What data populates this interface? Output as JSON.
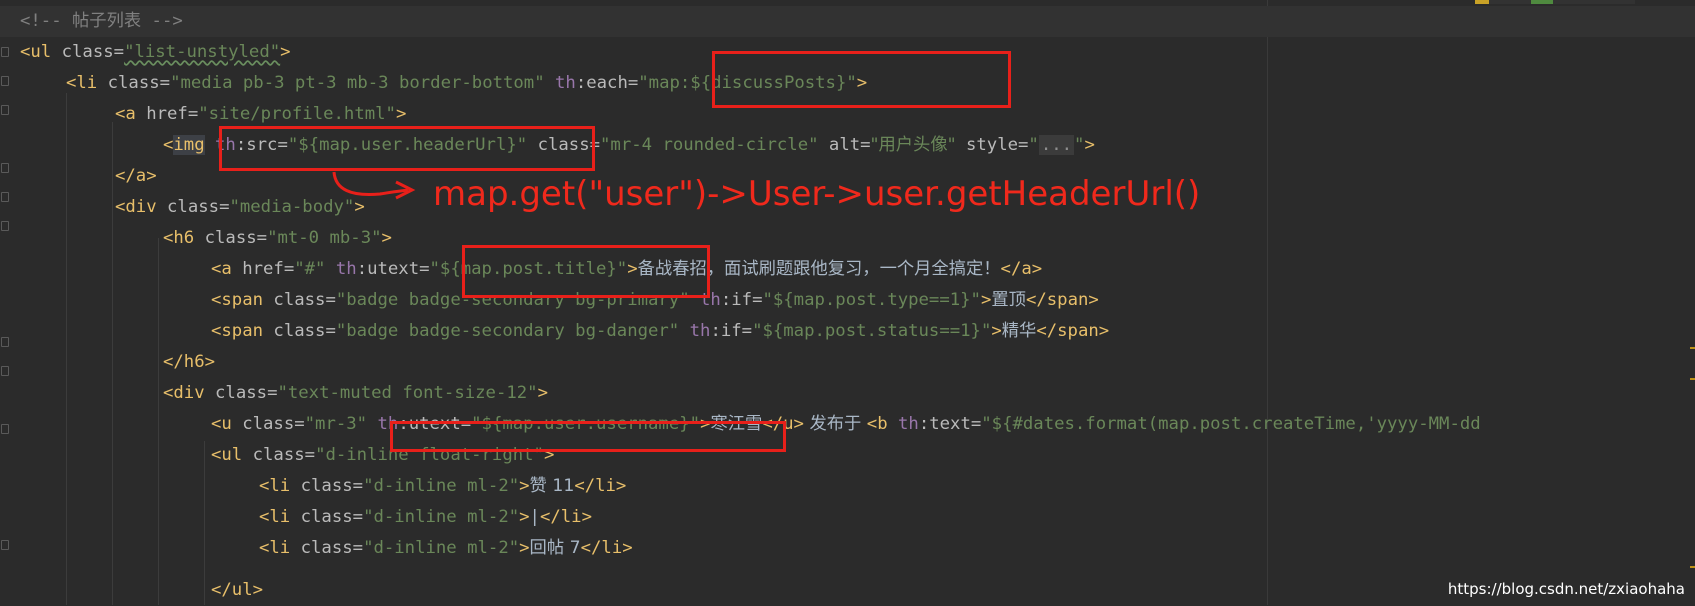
{
  "editor": {
    "line_1": {
      "comment": "<!-- 帖子列表 -->"
    },
    "line_2": {
      "lt": "<",
      "tag": "ul",
      "attr": " class",
      "eq": "=",
      "val": "\"list-unstyled\"",
      "gt": ">"
    },
    "line_3": {
      "lt": "<",
      "tag": "li",
      "a1": " class",
      "eq1": "=",
      "v1": "\"media pb-3 pt-3 mb-3 border-bottom\"",
      "ns": " th",
      "a2": ":each",
      "eq2": "=",
      "v2": "\"map:${discussPosts}\"",
      "gt": ">"
    },
    "line_4": {
      "lt": "<",
      "tag": "a",
      "attr": " href",
      "eq": "=",
      "val": "\"site/profile.html\"",
      "gt": ">"
    },
    "line_5": {
      "lt": "<",
      "tag": "img",
      "ns": "th",
      "a1": ":src",
      "eq1": "=",
      "v1": "\"${map.user.headerUrl}\"",
      "a2": " class",
      "eq2": "=",
      "v2": "\"mr-4 rounded-circle\"",
      "a3": " alt",
      "eq3": "=",
      "v3": "\"用户头像\"",
      "a4": " style",
      "eq4": "=",
      "q1": "\"",
      "fold": "...",
      "q2": "\"",
      "gt": ">"
    },
    "line_6": {
      "text": "</a>"
    },
    "line_7": {
      "lt": "<",
      "tag": "div",
      "attr": " class",
      "eq": "=",
      "val": "\"media-body\"",
      "gt": ">"
    },
    "line_8": {
      "lt": "<",
      "tag": "h6",
      "attr": " class",
      "eq": "=",
      "val": "\"mt-0 mb-3\"",
      "gt": ">"
    },
    "line_9": {
      "lt": "<",
      "tag": "a",
      "a1": " href",
      "eq1": "=",
      "v1": "\"#\"",
      "ns": " th",
      "a2": ":utext",
      "eq2": "=",
      "v2": "\"${map.post.title}\"",
      "gt": ">",
      "content": "备战春招，面试刷题跟他复习，一个月全搞定！",
      "close": "</a>"
    },
    "line_10": {
      "lt": "<",
      "tag": "span",
      "a1": " class",
      "eq1": "=",
      "v1": "\"badge badge-secondary bg-primary\"",
      "ns": " th",
      "a2": ":if",
      "eq2": "=",
      "v2": "\"${map.post.type==1}\"",
      "gt": ">",
      "content": "置顶",
      "close": "</span>"
    },
    "line_11": {
      "lt": "<",
      "tag": "span",
      "a1": " class",
      "eq1": "=",
      "v1": "\"badge badge-secondary bg-danger\"",
      "ns": " th",
      "a2": ":if",
      "eq2": "=",
      "v2": "\"${map.post.status==1}\"",
      "gt": ">",
      "content": "精华",
      "close": "</span>"
    },
    "line_12": {
      "text": "</h6>"
    },
    "line_13": {
      "lt": "<",
      "tag": "div",
      "attr": " class",
      "eq": "=",
      "val": "\"text-muted font-size-12\"",
      "gt": ">"
    },
    "line_14": {
      "lt": "<",
      "tag": "u",
      "a1": " class",
      "eq1": "=",
      "v1": "\"mr-3\"",
      "ns": " th",
      "a2": ":utext",
      "eq2": "=",
      "v2": "\"${map.user.username}\"",
      "gt": ">",
      "content": "寒江雪",
      "close": "</u>",
      "mid": " 发布于 ",
      "lt2": "<",
      "tag2": "b",
      "ns2": " th",
      "a3": ":text",
      "eq3": "=",
      "v3": "\"${#dates.format(map.post.createTime,'yyyy-MM-dd"
    },
    "line_15": {
      "lt": "<",
      "tag": "ul",
      "attr": " class",
      "eq": "=",
      "val": "\"d-inline float-right\"",
      "gt": ">"
    },
    "line_16": {
      "lt": "<",
      "tag": "li",
      "attr": " class",
      "eq": "=",
      "val": "\"d-inline ml-2\"",
      "gt": ">",
      "content": "赞 11",
      "close": "</li>"
    },
    "line_17": {
      "lt": "<",
      "tag": "li",
      "attr": " class",
      "eq": "=",
      "val": "\"d-inline ml-2\"",
      "gt": ">",
      "content": "|",
      "close": "</li>"
    },
    "line_18": {
      "lt": "<",
      "tag": "li",
      "attr": " class",
      "eq": "=",
      "val": "\"d-inline ml-2\"",
      "gt": ">",
      "content": "回帖 7",
      "close": "</li>"
    },
    "line_19": {
      "text": "</ul>"
    }
  },
  "annotation": {
    "text": "map.get(\"user\")->User->user.getHeaderUrl()"
  },
  "watermark": {
    "text": "https://blog.csdn.net/zxiaohaha"
  },
  "colors": {
    "highlight_box": "#e8201a",
    "annotation_text": "#f0291c",
    "tag": "#e8bf6a",
    "attribute": "#bababa",
    "string": "#6a8759",
    "namespace": "#9876aa",
    "comment": "#808080",
    "background": "#2b2b2b"
  }
}
